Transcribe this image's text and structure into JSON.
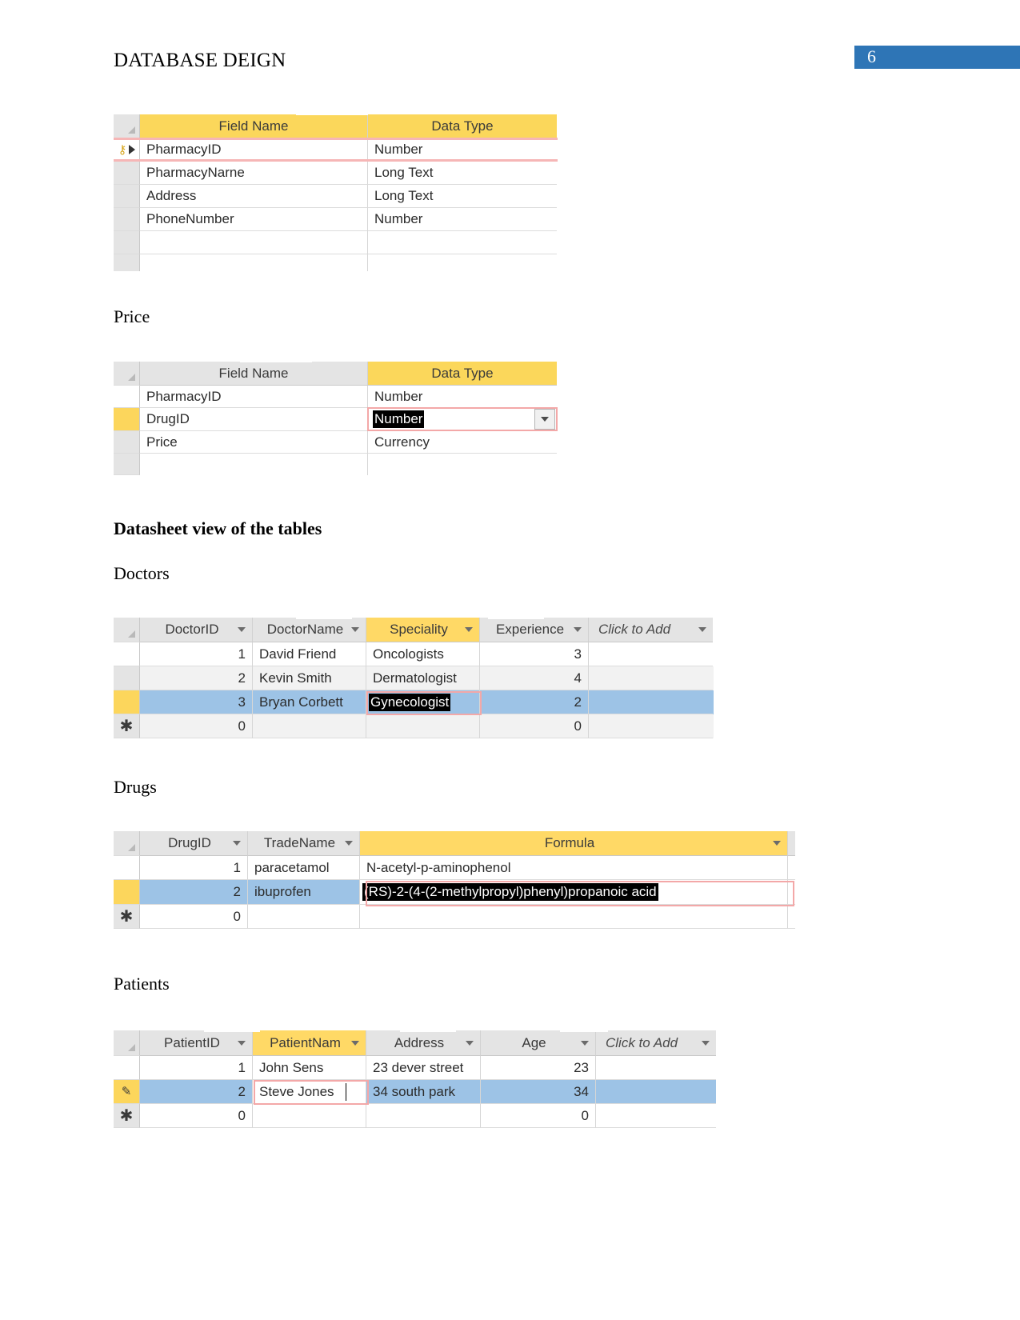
{
  "header": {
    "title": "DATABASE DEIGN",
    "page_number": "6",
    "banner_color": "#2e75b6"
  },
  "labels": {
    "price": "Price",
    "datasheet_heading": "Datasheet view of the tables",
    "doctors": "Doctors",
    "drugs": "Drugs",
    "patients": "Patients"
  },
  "design_table_pharmacy": {
    "columns": [
      "Field Name",
      "Data Type"
    ],
    "rows": [
      {
        "field": "PharmacyID",
        "type": "Number",
        "primary_key": true,
        "current": true
      },
      {
        "field": "PharmacyNarne",
        "type": "Long Text",
        "primary_key": false,
        "current": false
      },
      {
        "field": "Address",
        "type": "Long Text",
        "primary_key": false,
        "current": false
      },
      {
        "field": "PhoneNumber",
        "type": "Number",
        "primary_key": false,
        "current": false
      },
      {
        "field": "",
        "type": "",
        "primary_key": false,
        "current": false
      },
      {
        "field": "",
        "type": "",
        "primary_key": false,
        "current": false
      }
    ]
  },
  "design_table_price": {
    "columns": [
      "Field Name",
      "Data Type"
    ],
    "active_column": "Data Type",
    "rows": [
      {
        "field": "PharmacyID",
        "type": "Number",
        "selected_row": false,
        "type_selected": false
      },
      {
        "field": "DrugID",
        "type": "Number",
        "selected_row": true,
        "type_selected": true
      },
      {
        "field": "Price",
        "type": "Currency",
        "selected_row": false,
        "type_selected": false
      },
      {
        "field": "",
        "type": "",
        "selected_row": false,
        "type_selected": false
      }
    ]
  },
  "datasheet_doctors": {
    "columns": [
      "DoctorID",
      "DoctorName",
      "Speciality",
      "Experience"
    ],
    "add_column_label": "Click to Add",
    "active_column": "Speciality",
    "rows": [
      {
        "cells": [
          "1",
          "David Friend",
          "Oncologists",
          "3"
        ],
        "selected": false,
        "new_record": false
      },
      {
        "cells": [
          "2",
          "Kevin Smith",
          "Dermatologist",
          "4"
        ],
        "selected": false,
        "new_record": false
      },
      {
        "cells": [
          "3",
          "Bryan Corbett",
          "Gynecologist",
          "2"
        ],
        "selected": true,
        "new_record": false,
        "selected_cell_index": 2
      },
      {
        "cells": [
          "0",
          "",
          "",
          "0"
        ],
        "selected": false,
        "new_record": true
      }
    ]
  },
  "datasheet_drugs": {
    "columns": [
      "DrugID",
      "TradeName",
      "Formula"
    ],
    "active_column": "Formula",
    "rows": [
      {
        "cells": [
          "1",
          "paracetamol",
          "N-acetyl-p-aminophenol"
        ],
        "selected": false,
        "new_record": false
      },
      {
        "cells": [
          "2",
          "ibuprofen",
          "(RS)-2-(4-(2-methylpropyl)phenyl)propanoic acid"
        ],
        "selected": true,
        "new_record": false,
        "selected_cell_index": 2
      },
      {
        "cells": [
          "0",
          "",
          ""
        ],
        "selected": false,
        "new_record": true
      }
    ]
  },
  "datasheet_patients": {
    "columns": [
      "PatientID",
      "PatientNam",
      "Address",
      "Age"
    ],
    "add_column_label": "Click to Add",
    "active_column": "PatientNam",
    "rows": [
      {
        "cells": [
          "1",
          "John Sens",
          "23 dever street",
          "23"
        ],
        "selected": false,
        "new_record": false
      },
      {
        "cells": [
          "2",
          "Steve Jones",
          "34 south park",
          "34"
        ],
        "selected": true,
        "new_record": false,
        "editing_cell_index": 1
      },
      {
        "cells": [
          "0",
          "",
          "",
          "0"
        ],
        "selected": false,
        "new_record": true
      }
    ]
  },
  "icons": {
    "key": "⚷",
    "record_arrow": "▶",
    "new_record_star": "✱",
    "edit_pencil": "✎",
    "dropdown_caret": "▾"
  }
}
